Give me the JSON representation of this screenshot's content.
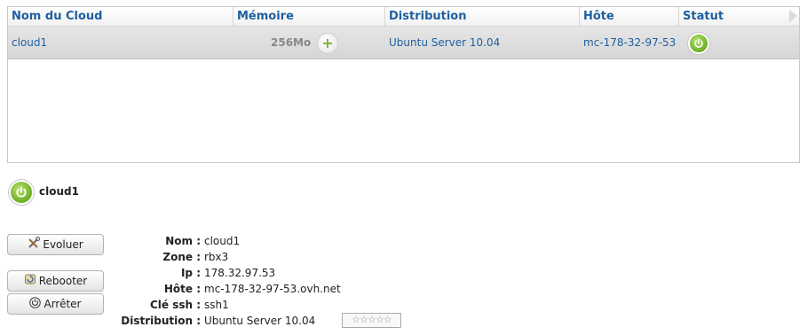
{
  "grid": {
    "columns": [
      "Nom du Cloud",
      "Mémoire",
      "Distribution",
      "Hôte",
      "Statut"
    ],
    "rows": [
      {
        "name": "cloud1",
        "memory": "256Mo",
        "distribution": "Ubuntu Server 10.04",
        "host": "mc-178-32-97-53.",
        "status": "power-on"
      }
    ]
  },
  "detail": {
    "name": "cloud1",
    "buttons": {
      "evoluer": "Evoluer",
      "rebooter": "Rebooter",
      "arreter": "Arrêter"
    },
    "fields": [
      {
        "label": "Nom :",
        "value": "cloud1"
      },
      {
        "label": "Zone :",
        "value": "rbx3"
      },
      {
        "label": "Ip :",
        "value": "178.32.97.53"
      },
      {
        "label": "Hôte :",
        "value": "mc-178-32-97-53.ovh.net"
      },
      {
        "label": "Clé ssh :",
        "value": "ssh1"
      },
      {
        "label": "Distribution :",
        "value": "Ubuntu Server 10.04"
      }
    ],
    "rating": "☆☆☆☆☆"
  },
  "colors": {
    "accent": "#1f5fa0",
    "status_green": "#6cae24",
    "row_bg": "#dedede"
  },
  "icons": {
    "status": "power-icon",
    "add_memory": "plus-icon",
    "evoluer": "tools-icon",
    "rebooter": "reboot-icon",
    "arreter": "power-icon",
    "scroll": "triangle-right-icon"
  }
}
